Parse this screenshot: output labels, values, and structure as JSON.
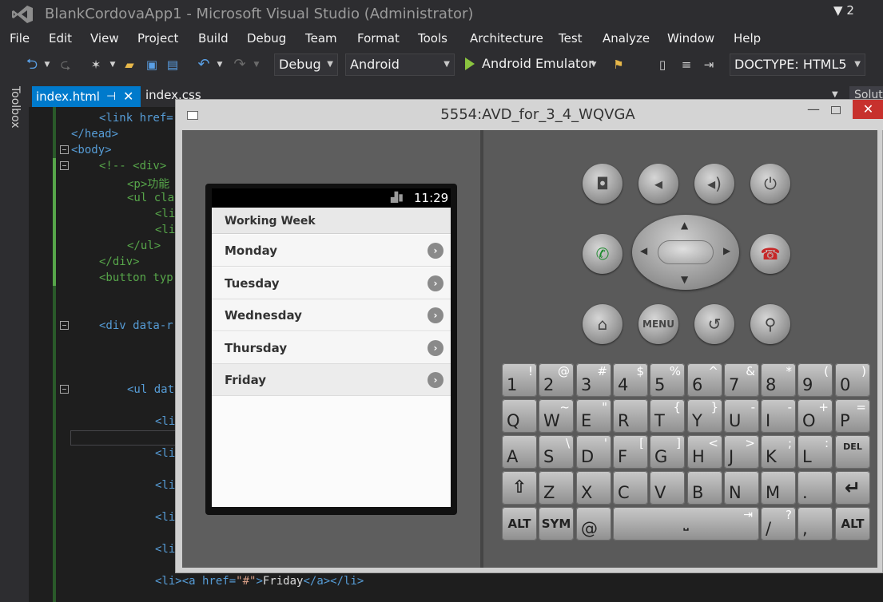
{
  "window": {
    "title": "BlankCordovaApp1 - Microsoft Visual Studio (Administrator)",
    "notifications": "2"
  },
  "menu": [
    "File",
    "Edit",
    "View",
    "Project",
    "Build",
    "Debug",
    "Team",
    "Format",
    "Tools",
    "Architecture",
    "Test",
    "Analyze",
    "Window",
    "Help"
  ],
  "toolbar": {
    "config": "Debug",
    "platform": "Android",
    "run_label": "Android Emulator",
    "doctype": "DOCTYPE: HTML5"
  },
  "toolbox_label": "Toolbox",
  "tabs": {
    "active": "index.html",
    "second": "index.css",
    "right": "Solut"
  },
  "code": {
    "l1": "<link href=",
    "l2": "</head>",
    "l3": "<body>",
    "l4": "<!-- <div>",
    "l5": "<p>功能",
    "l6": "<ul cla",
    "l7": "<li",
    "l8": "<li",
    "l9": "</ul>",
    "l10": "</div>",
    "l11": "<button typ",
    "l12": "<div data-r",
    "l13": "<ul dat",
    "l14": "<li",
    "l15": "<li",
    "l16": "<li",
    "l17": "<li",
    "l18": "<li",
    "l19_open": "<li><a href=",
    "l19_str": "\"#\"",
    "l19_mid": ">",
    "l19_txt": "Friday",
    "l19_close": "</a></li>"
  },
  "emulator": {
    "title": "5554:AVD_for_3_4_WQVGA",
    "clock": "11:29",
    "list_header": "Working Week",
    "days": [
      "Monday",
      "Tuesday",
      "Wednesday",
      "Thursday",
      "Friday"
    ],
    "menu_key": "MENU",
    "keyboard": {
      "row1": [
        [
          "1",
          "!"
        ],
        [
          "2",
          "@"
        ],
        [
          "3",
          "#"
        ],
        [
          "4",
          "$"
        ],
        [
          "5",
          "%"
        ],
        [
          "6",
          "^"
        ],
        [
          "7",
          "&"
        ],
        [
          "8",
          "*"
        ],
        [
          "9",
          "("
        ],
        [
          "0",
          ")"
        ]
      ],
      "row2": [
        [
          "Q",
          ""
        ],
        [
          "W",
          "~"
        ],
        [
          "E",
          "\""
        ],
        [
          "R",
          ""
        ],
        [
          "T",
          "{"
        ],
        [
          "Y",
          "}"
        ],
        [
          "U",
          "-"
        ],
        [
          "I",
          "-"
        ],
        [
          "O",
          "+"
        ],
        [
          "P",
          "="
        ]
      ],
      "row3": [
        [
          "A",
          ""
        ],
        [
          "S",
          "\\"
        ],
        [
          "D",
          "'"
        ],
        [
          "F",
          "["
        ],
        [
          "G",
          "]"
        ],
        [
          "H",
          "<"
        ],
        [
          "J",
          ">"
        ],
        [
          "K",
          ";"
        ],
        [
          "L",
          ":"
        ]
      ],
      "row4": [
        [
          "Z",
          ""
        ],
        [
          "X",
          ""
        ],
        [
          "C",
          ""
        ],
        [
          "V",
          ""
        ],
        [
          "B",
          ""
        ],
        [
          "N",
          ""
        ],
        [
          "M",
          ""
        ],
        [
          ".",
          ""
        ]
      ],
      "del": "DEL",
      "alt": "ALT",
      "sym": "SYM",
      "at": "@",
      "slash": "/",
      "question": "?",
      "comma": ","
    }
  }
}
